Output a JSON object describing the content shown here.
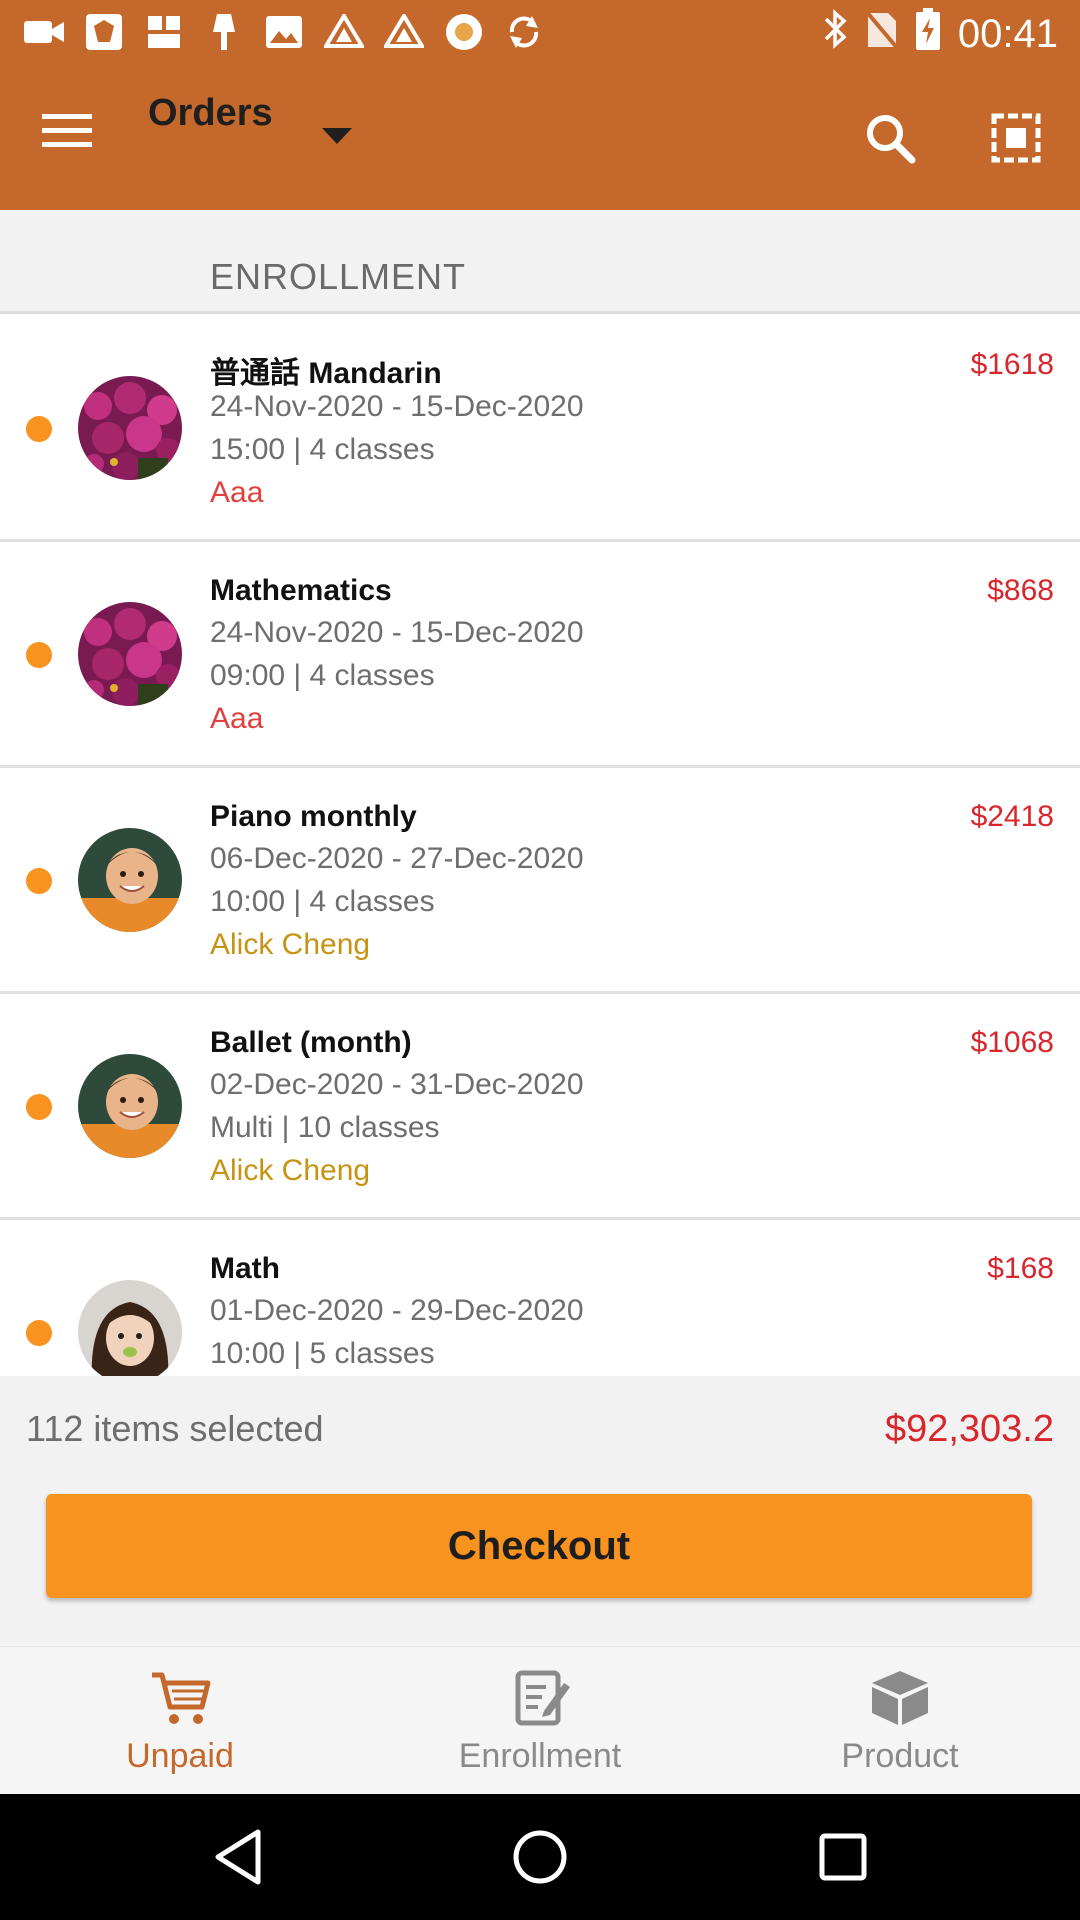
{
  "status_bar": {
    "time": "00:41",
    "icons": [
      "video-icon",
      "app-logo-icon",
      "chinese-app-icon",
      "lamp-icon",
      "image-icon",
      "drive-icon",
      "drive-icon-2",
      "record-icon",
      "sync-icon",
      "bluetooth-icon",
      "no-sim-icon",
      "battery-charging-icon"
    ]
  },
  "app_bar": {
    "title": "Orders"
  },
  "section": {
    "header": "ENROLLMENT"
  },
  "orders": [
    {
      "title": "普通話 Mandarin",
      "price": "$1618",
      "dates": "24-Nov-2020 - 15-Dec-2020",
      "time": "15:00 | 4 classes",
      "person": "Aaa",
      "person_color": "#e0403e",
      "avatar": "flowers"
    },
    {
      "title": "Mathematics",
      "price": "$868",
      "dates": "24-Nov-2020 - 15-Dec-2020",
      "time": "09:00 | 4 classes",
      "person": "Aaa",
      "person_color": "#e0403e",
      "avatar": "flowers"
    },
    {
      "title": "Piano monthly",
      "price": "$2418",
      "dates": "06-Dec-2020 - 27-Dec-2020",
      "time": "10:00 | 4 classes",
      "person": "Alick Cheng",
      "person_color": "#c69414",
      "avatar": "boy"
    },
    {
      "title": "Ballet (month)",
      "price": "$1068",
      "dates": "02-Dec-2020 - 31-Dec-2020",
      "time": "Multi | 10 classes",
      "person": "Alick Cheng",
      "person_color": "#c69414",
      "avatar": "boy"
    },
    {
      "title": "Math",
      "price": "$168",
      "dates": "01-Dec-2020 - 29-Dec-2020",
      "time": "10:00 | 5 classes",
      "person": "",
      "person_color": "#c69414",
      "avatar": "girl"
    }
  ],
  "summary": {
    "count": "112 items selected",
    "total": "$92,303.2",
    "checkout_label": "Checkout"
  },
  "bottom_nav": {
    "items": [
      {
        "label": "Unpaid",
        "icon": "cart-icon",
        "active": true
      },
      {
        "label": "Enrollment",
        "icon": "edit-document-icon",
        "active": false
      },
      {
        "label": "Product",
        "icon": "box-icon",
        "active": false
      }
    ]
  },
  "colors": {
    "primary": "#c4692b",
    "accent": "#f7931e",
    "price": "#d9262c"
  }
}
